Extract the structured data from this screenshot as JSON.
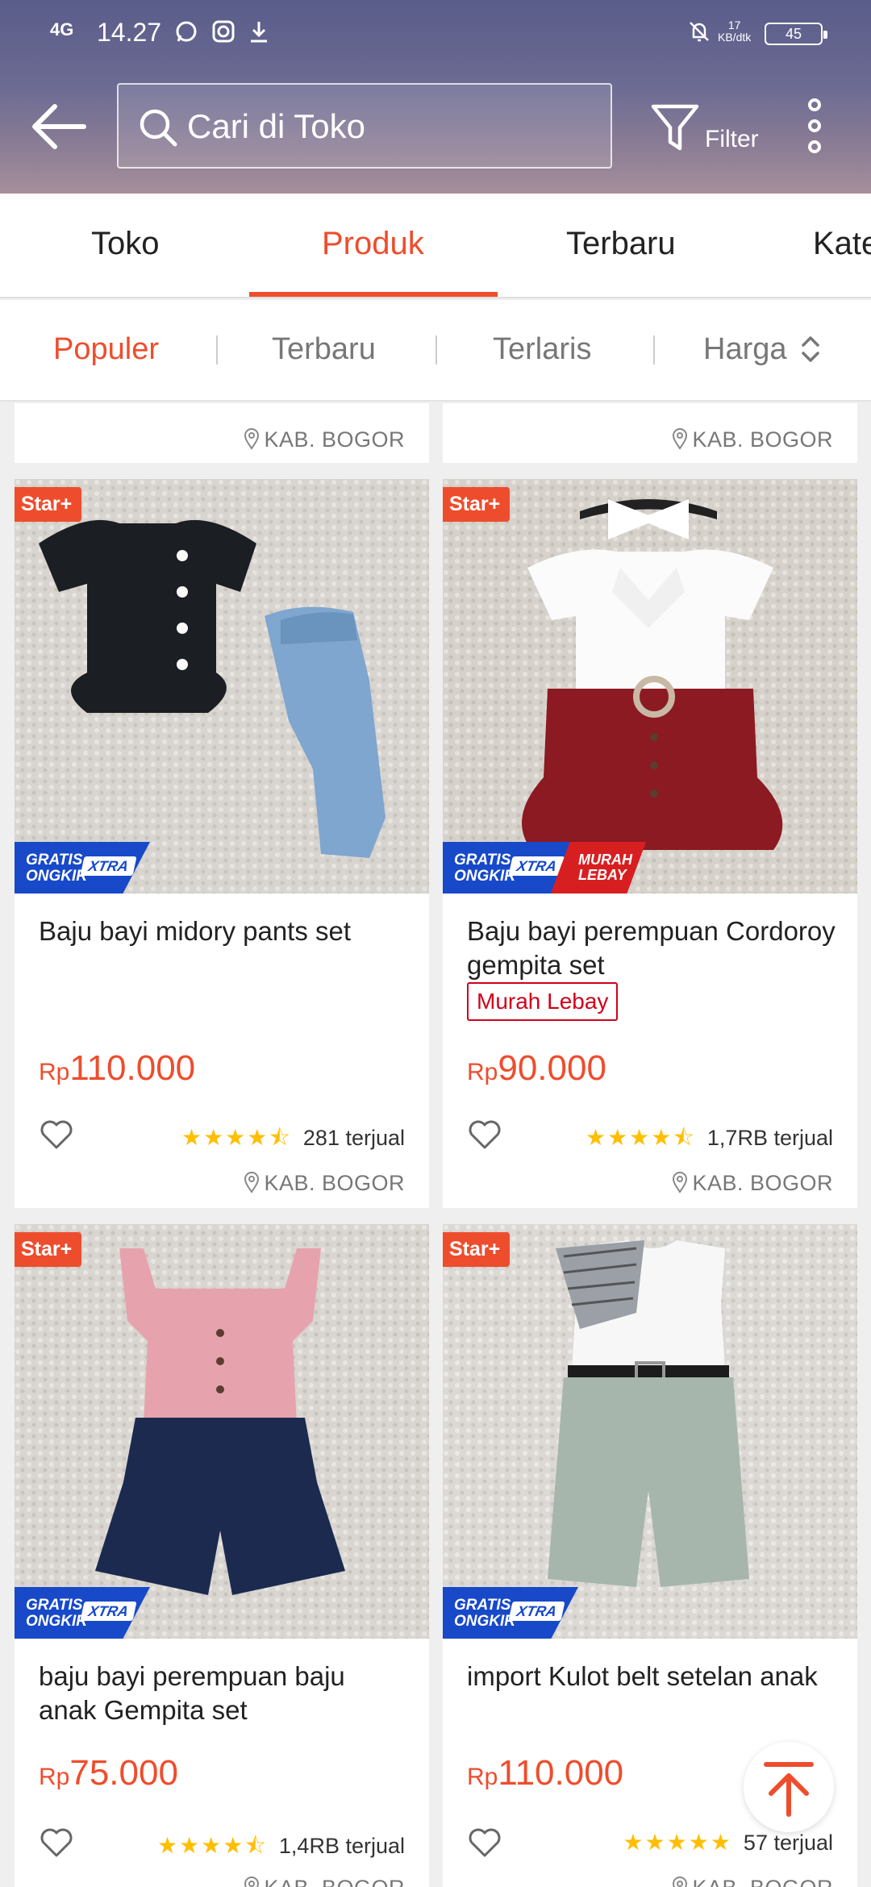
{
  "status": {
    "network": "4G",
    "time": "14.27",
    "speed_value": "17",
    "speed_unit": "KB/dtk",
    "battery": "45"
  },
  "header": {
    "search_placeholder": "Cari di Toko",
    "filter_label": "Filter"
  },
  "tabs": [
    {
      "label": "Toko"
    },
    {
      "label": "Produk"
    },
    {
      "label": "Terbaru"
    },
    {
      "label": "Kate"
    }
  ],
  "sort": [
    {
      "label": "Populer"
    },
    {
      "label": "Terbaru"
    },
    {
      "label": "Terlaris"
    },
    {
      "label": "Harga"
    }
  ],
  "top_locations": [
    "KAB. BOGOR",
    "KAB. BOGOR"
  ],
  "badges": {
    "star": "Star+",
    "gratis_line1": "GRATIS",
    "gratis_line2": "ONGKIR",
    "xtra": "XTRA",
    "murah_line1": "MURAH",
    "murah_line2": "LEBAY"
  },
  "products": [
    {
      "name": "Baju bayi midory pants set",
      "currency": "Rp",
      "price": "110.000",
      "rating": 4.5,
      "sold": "281 terjual",
      "location": "KAB. BOGOR"
    },
    {
      "name": "Baju bayi perempuan Cordoroy gempita set",
      "tag": "Murah Lebay",
      "currency": "Rp",
      "price": "90.000",
      "rating": 4.5,
      "sold": "1,7RB terjual",
      "location": "KAB. BOGOR"
    },
    {
      "name": "baju bayi perempuan baju anak Gempita set",
      "currency": "Rp",
      "price": "75.000",
      "rating": 4.5,
      "sold": "1,4RB terjual",
      "location": "KAB. BOGOR"
    },
    {
      "name": "import Kulot belt setelan anak",
      "currency": "Rp",
      "price": "110.000",
      "rating": 5,
      "sold": "57 terjual",
      "location": "KAB. BOGOR"
    }
  ],
  "colors": {
    "accent": "#ee4d2d",
    "gratis": "#1749c9",
    "murah": "#d71f21",
    "star": "#ffbf00"
  }
}
